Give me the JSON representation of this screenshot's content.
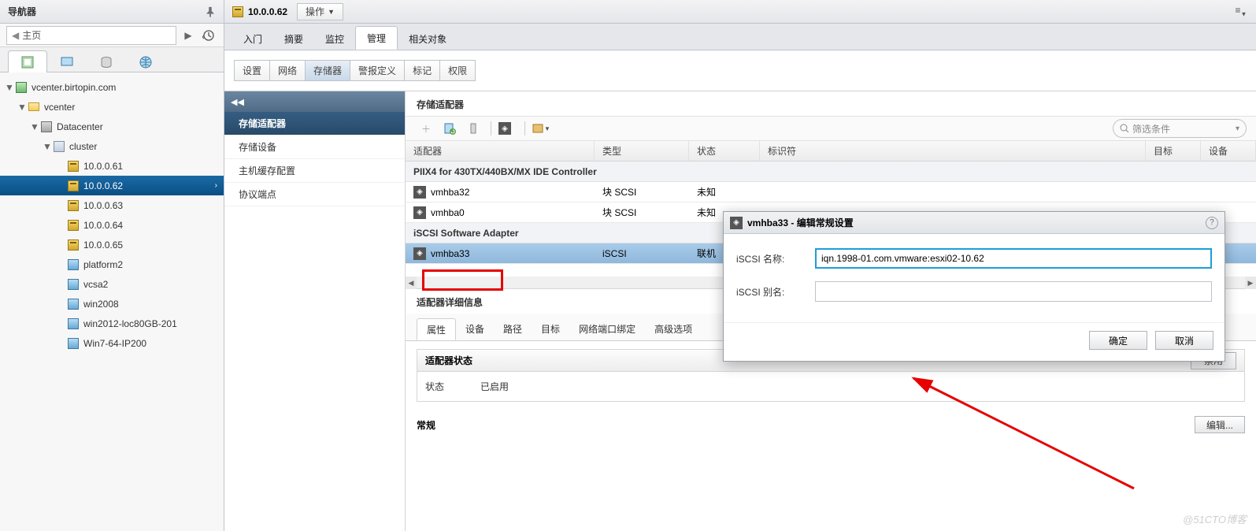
{
  "sidebar": {
    "title": "导航器",
    "home": "主页",
    "tree": {
      "vcenter": "vcenter.birtopin.com",
      "folder": "vcenter",
      "datacenter": "Datacenter",
      "cluster": "cluster",
      "hosts": [
        "10.0.0.61",
        "10.0.0.62",
        "10.0.0.63",
        "10.0.0.64",
        "10.0.0.65"
      ],
      "vms": [
        "platform2",
        "vcsa2",
        "win2008",
        "win2012-loc80GB-201",
        "Win7-64-IP200"
      ]
    }
  },
  "main": {
    "title_host": "10.0.0.62",
    "actions": "操作",
    "tabs": [
      "入门",
      "摘要",
      "监控",
      "管理",
      "相关对象"
    ],
    "subtabs": [
      "设置",
      "网络",
      "存储器",
      "警报定义",
      "标记",
      "权限"
    ],
    "left_items": [
      "存储适配器",
      "存储设备",
      "主机缓存配置",
      "协议端点"
    ],
    "section_title": "存储适配器",
    "filter_ph": "筛选条件",
    "cols": [
      "适配器",
      "类型",
      "状态",
      "标识符",
      "目标",
      "设备"
    ],
    "group1": "PIIX4 for 430TX/440BX/MX IDE Controller",
    "rows": [
      {
        "name": "vmhba32",
        "type": "块 SCSI",
        "state": "未知"
      },
      {
        "name": "vmhba0",
        "type": "块 SCSI",
        "state": "未知"
      }
    ],
    "group2": "iSCSI Software Adapter",
    "row_sel": {
      "name": "vmhba33",
      "type": "iSCSI",
      "state": "联机"
    },
    "detail_title": "适配器详细信息",
    "dtabs": [
      "属性",
      "设备",
      "路径",
      "目标",
      "网络端口绑定",
      "高级选项"
    ],
    "panel1_title": "适配器状态",
    "panel1_btn": "禁用",
    "status_k": "状态",
    "status_v": "已启用",
    "general_title": "常规",
    "edit_btn": "编辑..."
  },
  "dialog": {
    "title": "vmhba33 - 编辑常规设置",
    "f1_label": "iSCSI 名称:",
    "f1_value": "iqn.1998-01.com.vmware:esxi02-10.62",
    "f2_label": "iSCSI 别名:",
    "f2_value": "",
    "ok": "确定",
    "cancel": "取消"
  },
  "watermark": "@51CTO博客"
}
